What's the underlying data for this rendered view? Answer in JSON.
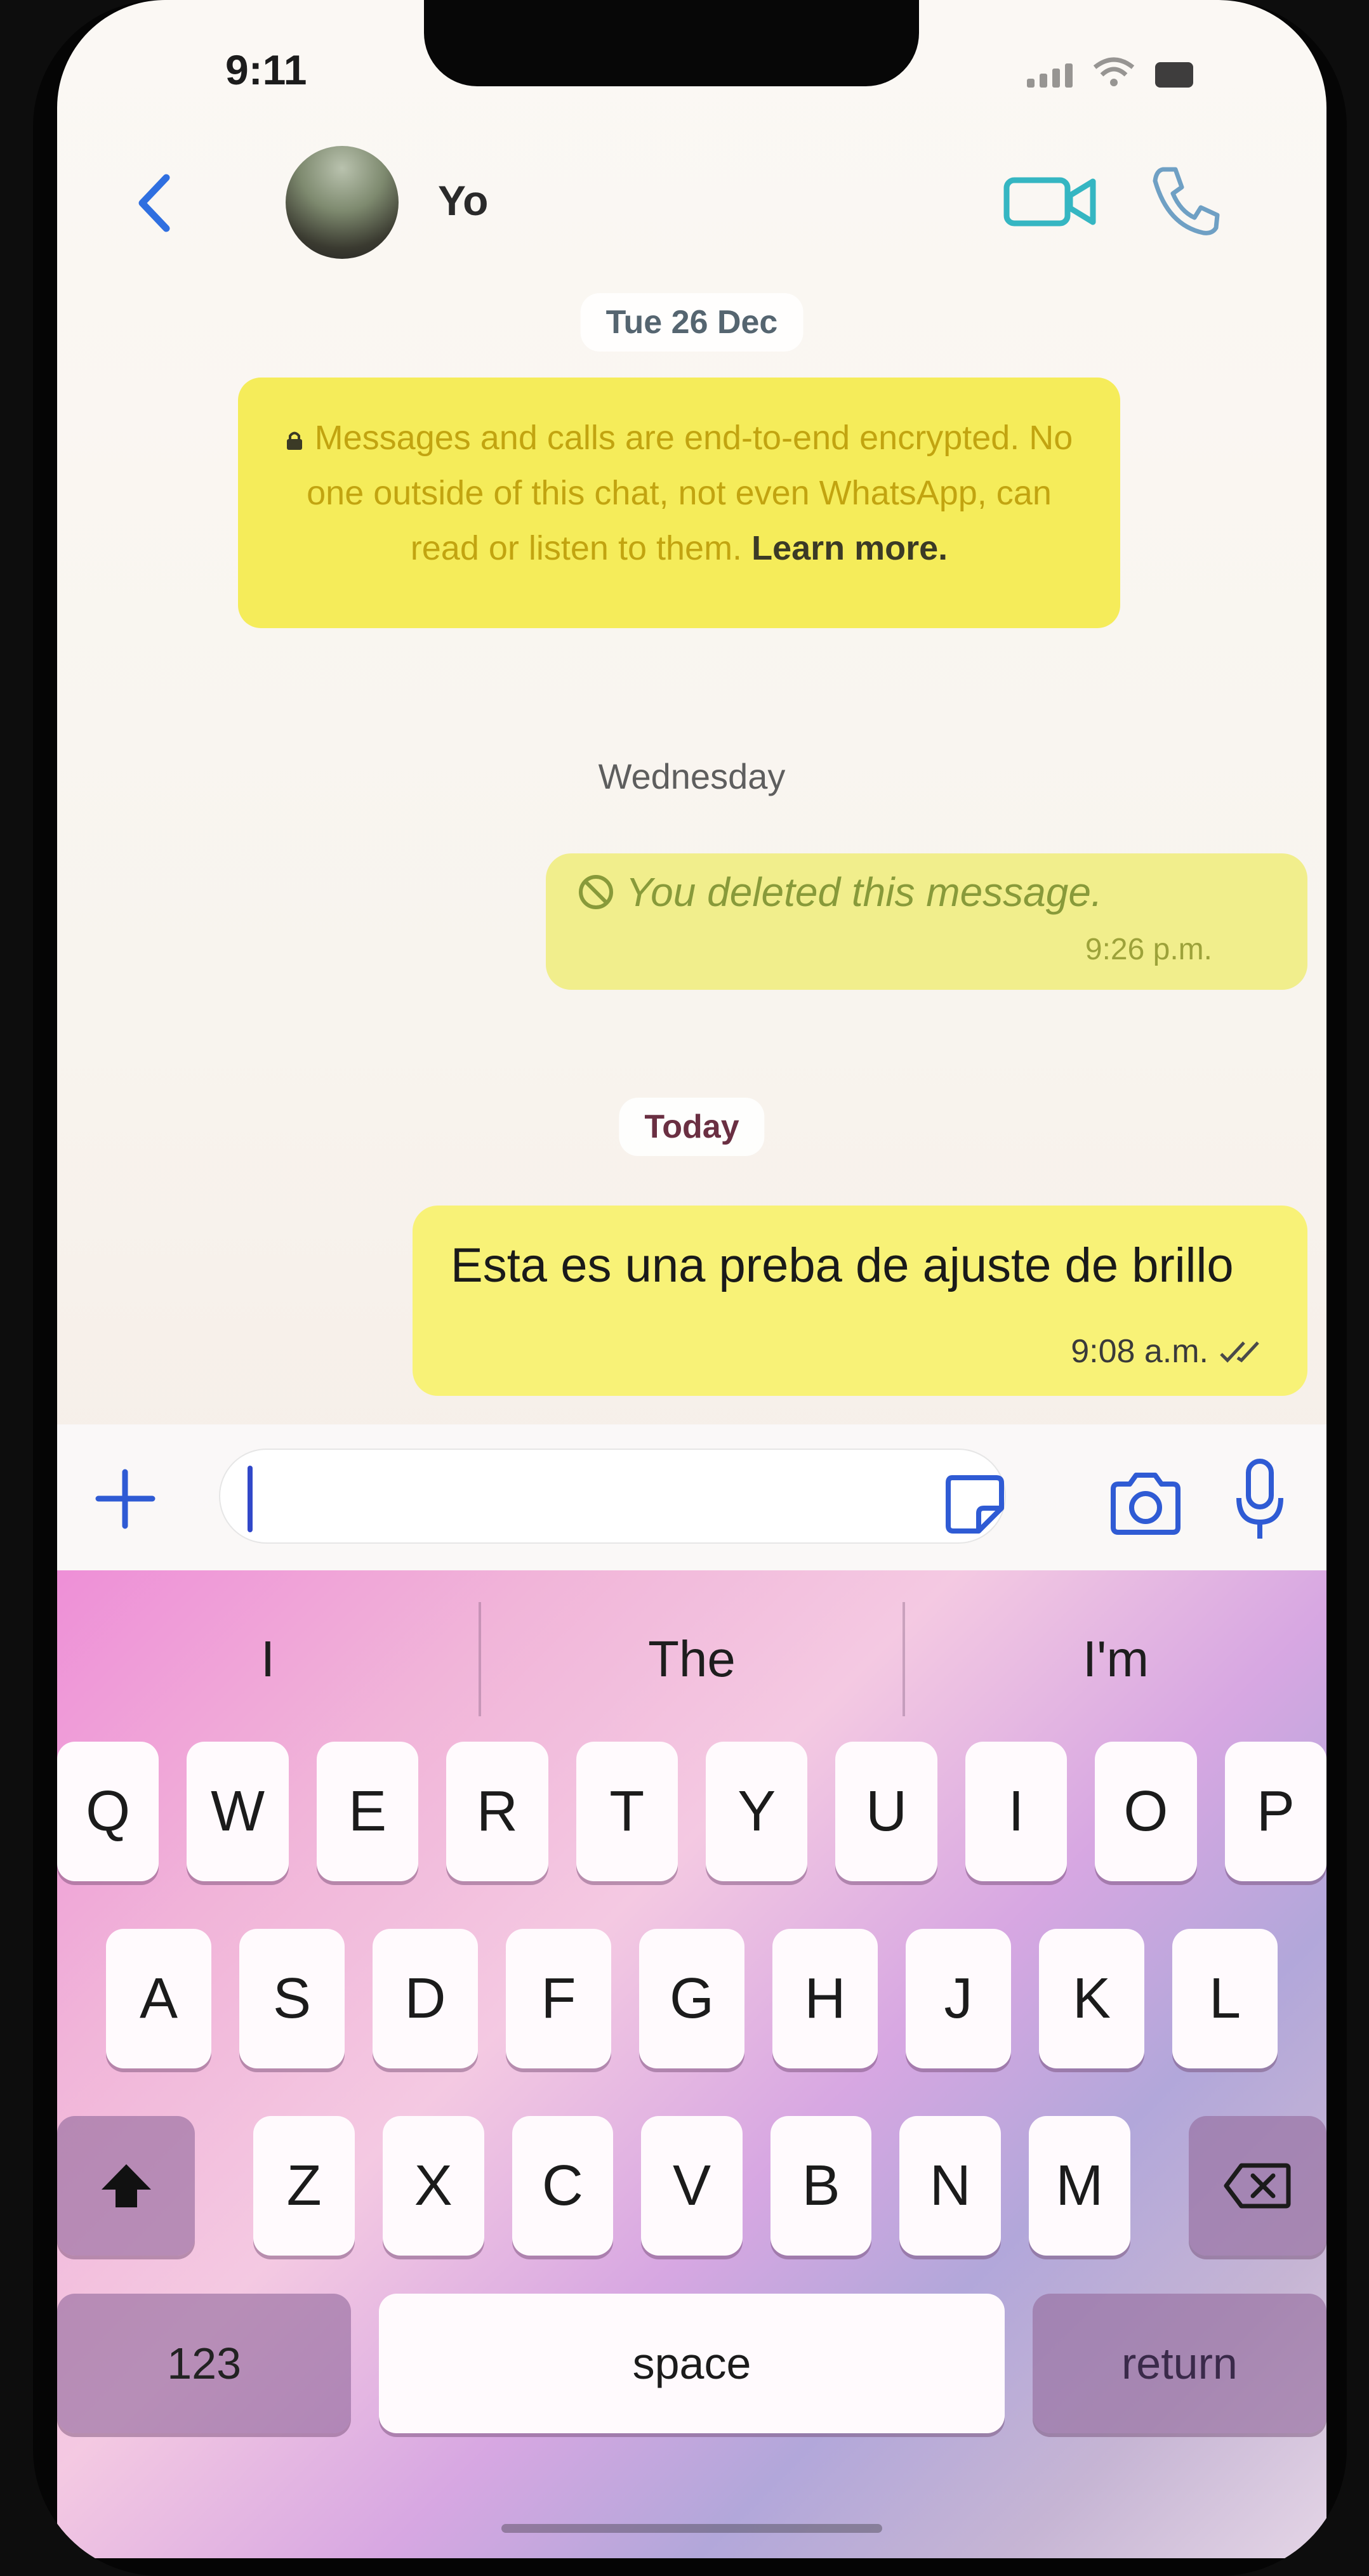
{
  "status_bar": {
    "time": "9:11"
  },
  "header": {
    "contact_name": "Yo"
  },
  "dates": {
    "first": "Tue 26 Dec",
    "second": "Wednesday",
    "third": "Today"
  },
  "encryption": {
    "text": "Messages and calls are end-to-end encrypted. No one outside of this chat, not even WhatsApp, can read or listen to them.",
    "link": "Learn more."
  },
  "messages": {
    "deleted": {
      "text": "You deleted this message.",
      "time": "9:26 p.m."
    },
    "outgoing": {
      "text": "Esta es una preba de ajuste de brillo",
      "time": "9:08 a.m."
    }
  },
  "composer": {
    "value": ""
  },
  "keyboard": {
    "suggestions": [
      "I",
      "The",
      "I'm"
    ],
    "row1": [
      "Q",
      "W",
      "E",
      "R",
      "T",
      "Y",
      "U",
      "I",
      "O",
      "P"
    ],
    "row2": [
      "A",
      "S",
      "D",
      "F",
      "G",
      "H",
      "J",
      "K",
      "L"
    ],
    "row3": [
      "Z",
      "X",
      "C",
      "V",
      "B",
      "N",
      "M"
    ],
    "numbers": "123",
    "space": "space",
    "return": "return"
  },
  "colors": {
    "accent": "#2f5bd4",
    "encryption_bg": "#f5ec5a",
    "outgoing_bg": "#f8f277"
  },
  "icons": [
    "back-icon",
    "video-call-icon",
    "phone-call-icon",
    "lock-icon",
    "deleted-icon",
    "read-ticks-icon",
    "plus-icon",
    "sticker-icon",
    "camera-icon",
    "microphone-icon",
    "shift-icon",
    "backspace-icon"
  ]
}
